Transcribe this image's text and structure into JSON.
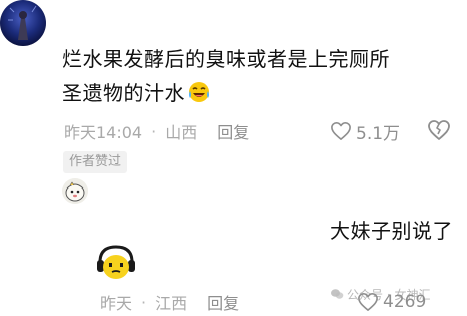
{
  "comment": {
    "text_line1": "烂水果发酵后的臭味或者是上完厕所",
    "text_line2": "圣遗物的汁水",
    "emoji": "laughing-tears-emoji",
    "time": "昨天14:04",
    "separator": "·",
    "location": "山西",
    "reply_label": "回复",
    "like_count": "5.1万",
    "author_badge": "作者赞过"
  },
  "reply": {
    "text": "大妹子别说了",
    "time": "昨天",
    "separator": "·",
    "location": "江西",
    "reply_label": "回复",
    "like_count": "4269"
  },
  "watermark": {
    "text": "公众号 · 女神汇"
  },
  "colors": {
    "text_primary": "#111111",
    "text_meta": "#a9a9a9",
    "icon_gray": "#8e8e8e",
    "badge_bg": "#f1f1f1",
    "avatar_yellow": "#f7d21e"
  }
}
